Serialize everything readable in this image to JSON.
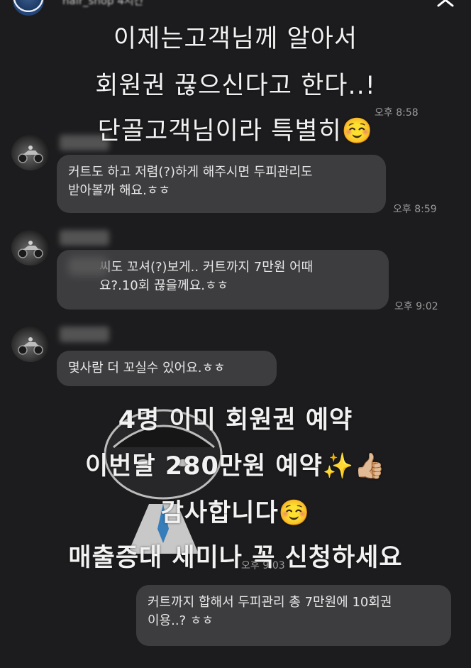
{
  "story": {
    "username": "hair_shop",
    "elapsed": "4시간"
  },
  "overlay": {
    "line1": "이제는고객님께 알아서",
    "line2": "회원권 끊으신다고 한다..!",
    "line3": "단골고객님이라 특별히☺️",
    "line4": "4명 이미 회원권 예약",
    "line5": "이번달 280만원 예약✨👍🏼",
    "line6": "감사합니다☺️",
    "line7": "매출증대 세미나 꼭 신청하세요"
  },
  "chat": {
    "messages": [
      {
        "text": "커트도 하고 저렴(?)하게 해주시면 두피관리도\n받아볼까 해요.ㅎㅎ",
        "time": "오후 8:59"
      },
      {
        "text": "씨도 꼬셔(?)보게.. 커트까지 7만원 어때\n요?.10회 끊을께요.ㅎㅎ",
        "time": "오후 9:02"
      },
      {
        "text": "몇사람 더 꼬실수 있어요.ㅎㅎ",
        "time": ""
      },
      {
        "text": "커트까지 합해서 두피관리 총 7만원에 10회권\n이용..? ㅎㅎ",
        "time": ""
      }
    ],
    "hidden_times": [
      "오후 8:58",
      "오후 9:03"
    ]
  }
}
